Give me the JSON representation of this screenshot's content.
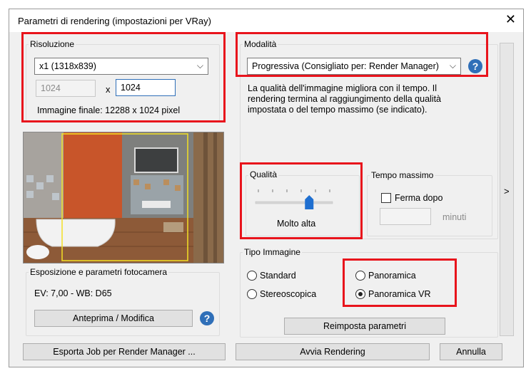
{
  "window": {
    "title": "Parametri di rendering (impostazioni per VRay)",
    "close_glyph": "✕"
  },
  "resolution": {
    "group_label": "Risoluzione",
    "select_value": "x1 (1318x839)",
    "width_value": "1024",
    "times_label": "x",
    "height_value": "1024",
    "final_image_text": "Immagine finale: 12288 x 1024 pixel"
  },
  "mode": {
    "group_label": "Modalità",
    "select_value": "Progressiva (Consigliato per: Render Manager)",
    "description": "La qualità dell'immagine migliora con il tempo. Il rendering termina al raggiungimento della qualità impostata o del tempo massimo (se indicato)."
  },
  "quality": {
    "group_label": "Qualità",
    "value_label": "Molto alta",
    "slider_fraction": 0.71
  },
  "max_time": {
    "group_label": "Tempo massimo",
    "stop_after_label": "Ferma dopo",
    "minutes_value": "",
    "unit_label": "minuti"
  },
  "exposure": {
    "group_label": "Esposizione e parametri fotocamera",
    "values_text": "EV: 7,00 - WB: D65",
    "preview_button": "Anteprima / Modifica"
  },
  "image_type": {
    "group_label": "Tipo Immagine",
    "options": [
      "Standard",
      "Stereoscopica",
      "Panoramica",
      "Panoramica VR"
    ],
    "selected": "Panoramica VR"
  },
  "buttons": {
    "reset": "Reimposta parametri",
    "export_job": "Esporta Job per Render Manager ...",
    "start": "Avvia Rendering",
    "cancel": "Annulla",
    "expand": ">"
  },
  "icons": {
    "help": "?",
    "chevron": "⌵"
  },
  "colors": {
    "highlight_red": "#e8141c",
    "help_blue": "#2f6fb8",
    "thumb_blue": "#1f6fd0"
  }
}
